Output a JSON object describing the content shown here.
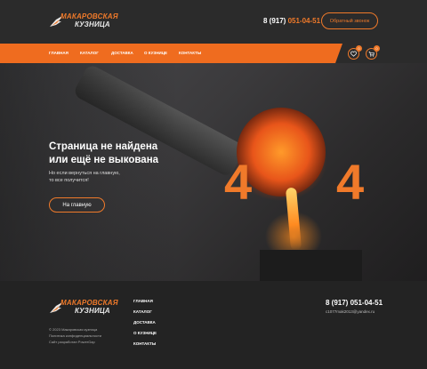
{
  "header": {
    "logo_line1": "Макаровская",
    "logo_line2": "кузница",
    "phone_prefix": "8 (917) ",
    "phone_number": "051-04-51",
    "callback_label": "Обратный звонок"
  },
  "nav": {
    "items": [
      "Главная",
      "Каталог",
      "Доставка",
      "О кузнице",
      "Контакты"
    ],
    "favorites_count": "0",
    "cart_count": "0"
  },
  "hero": {
    "title_line1": "Страница не найдена",
    "title_line2": "или ещё не выкована",
    "subtitle_line1": "Но если вернуться на главную,",
    "subtitle_line2": "то все получится!",
    "home_button": "На главную",
    "code_digit1": "4",
    "code_digit2": "4"
  },
  "footer": {
    "logo_line1": "Макаровская",
    "logo_line2": "кузница",
    "copyright": "© 2023 Макаровская кузница",
    "policy": "Политика конфиденциальности",
    "developer": "Сайт разработан PowerGap",
    "nav_items": [
      "Главная",
      "Каталог",
      "Доставка",
      "О кузнице",
      "Контакты"
    ],
    "phone": "8 (917) 051-04-51",
    "email": "c1077mak2013@yandex.ru"
  },
  "colors": {
    "accent": "#f07a2a",
    "nav_bar": "#ef6c1f",
    "header_bg": "#2b2b2b",
    "footer_bg": "#232323"
  }
}
